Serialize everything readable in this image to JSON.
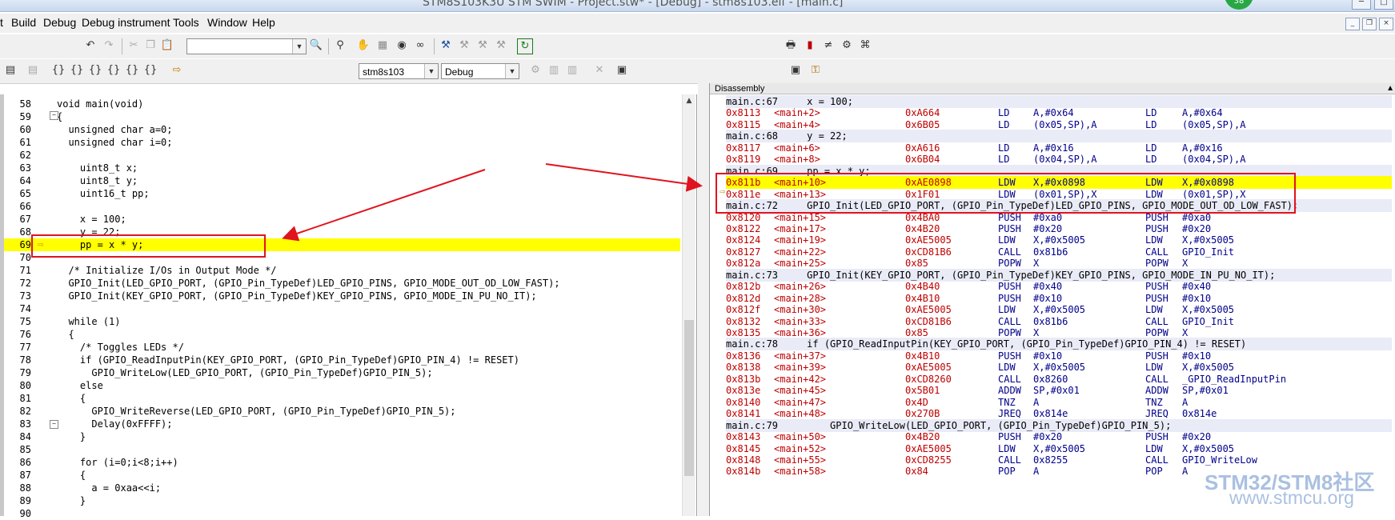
{
  "window": {
    "title": "STM8S103K3U STM SWIM - Project.stw* - [Debug] - stm8s103.elf - [main.c]",
    "badge": "38"
  },
  "menu": [
    "t",
    "Build",
    "Debug",
    "Debug instrument",
    "Tools",
    "Window",
    "Help"
  ],
  "toolbar": {
    "search_combo": "",
    "target_combo": "stm8s103",
    "config_combo": "Debug"
  },
  "editor": {
    "lines": [
      {
        "n": "58",
        "t": "void main(void)"
      },
      {
        "n": "59",
        "t": "{"
      },
      {
        "n": "60",
        "t": "  unsigned char a=0;"
      },
      {
        "n": "61",
        "t": "  unsigned char i=0;"
      },
      {
        "n": "62",
        "t": ""
      },
      {
        "n": "63",
        "t": "    uint8_t x;"
      },
      {
        "n": "64",
        "t": "    uint8_t y;"
      },
      {
        "n": "65",
        "t": "    uint16_t pp;"
      },
      {
        "n": "66",
        "t": ""
      },
      {
        "n": "67",
        "t": "    x = 100;"
      },
      {
        "n": "68",
        "t": "    y = 22;"
      },
      {
        "n": "69",
        "t": "    pp = x * y;"
      },
      {
        "n": "70",
        "t": ""
      },
      {
        "n": "71",
        "t": "  /* Initialize I/Os in Output Mode */"
      },
      {
        "n": "72",
        "t": "  GPIO_Init(LED_GPIO_PORT, (GPIO_Pin_TypeDef)LED_GPIO_PINS, GPIO_MODE_OUT_OD_LOW_FAST);"
      },
      {
        "n": "73",
        "t": "  GPIO_Init(KEY_GPIO_PORT, (GPIO_Pin_TypeDef)KEY_GPIO_PINS, GPIO_MODE_IN_PU_NO_IT);"
      },
      {
        "n": "74",
        "t": ""
      },
      {
        "n": "75",
        "t": "  while (1)"
      },
      {
        "n": "76",
        "t": "  {"
      },
      {
        "n": "77",
        "t": "    /* Toggles LEDs */"
      },
      {
        "n": "78",
        "t": "    if (GPIO_ReadInputPin(KEY_GPIO_PORT, (GPIO_Pin_TypeDef)GPIO_PIN_4) != RESET)"
      },
      {
        "n": "79",
        "t": "      GPIO_WriteLow(LED_GPIO_PORT, (GPIO_Pin_TypeDef)GPIO_PIN_5);"
      },
      {
        "n": "80",
        "t": "    else"
      },
      {
        "n": "81",
        "t": "    {"
      },
      {
        "n": "82",
        "t": "      GPIO_WriteReverse(LED_GPIO_PORT, (GPIO_Pin_TypeDef)GPIO_PIN_5);"
      },
      {
        "n": "83",
        "t": "      Delay(0xFFFF);"
      },
      {
        "n": "84",
        "t": "    }"
      },
      {
        "n": "85",
        "t": ""
      },
      {
        "n": "86",
        "t": "    for (i=0;i<8;i++)"
      },
      {
        "n": "87",
        "t": "    {"
      },
      {
        "n": "88",
        "t": "      a = 0xaa<<i;"
      },
      {
        "n": "89",
        "t": "    }"
      },
      {
        "n": "90",
        "t": ""
      }
    ]
  },
  "disassembly": {
    "title": "Disassembly",
    "rows": [
      {
        "kind": "src",
        "text": "main.c:67     x = 100;"
      },
      {
        "kind": "asm",
        "addr": "0x8113",
        "sym": "<main+2>",
        "hex": "0xA664",
        "op": "LD",
        "arg": "A,#0x64",
        "op2": "LD",
        "arg2": "A,#0x64"
      },
      {
        "kind": "asm",
        "addr": "0x8115",
        "sym": "<main+4>",
        "hex": "0x6B05",
        "op": "LD",
        "arg": "(0x05,SP),A",
        "op2": "LD",
        "arg2": "(0x05,SP),A"
      },
      {
        "kind": "src",
        "text": "main.c:68     y = 22;"
      },
      {
        "kind": "asm",
        "addr": "0x8117",
        "sym": "<main+6>",
        "hex": "0xA616",
        "op": "LD",
        "arg": "A,#0x16",
        "op2": "LD",
        "arg2": "A,#0x16"
      },
      {
        "kind": "asm",
        "addr": "0x8119",
        "sym": "<main+8>",
        "hex": "0x6B04",
        "op": "LD",
        "arg": "(0x04,SP),A",
        "op2": "LD",
        "arg2": "(0x04,SP),A"
      },
      {
        "kind": "src",
        "text": "main.c:69     pp = x * y;"
      },
      {
        "kind": "cur",
        "addr": "0x811b",
        "sym": "<main+10>",
        "hex": "0xAE0898",
        "op": "LDW",
        "arg": "X,#0x0898",
        "op2": "LDW",
        "arg2": "X,#0x0898"
      },
      {
        "kind": "asm",
        "addr": "0x811e",
        "sym": "<main+13>",
        "hex": "0x1F01",
        "op": "LDW",
        "arg": "(0x01,SP),X",
        "op2": "LDW",
        "arg2": "(0x01,SP),X"
      },
      {
        "kind": "src",
        "text": "main.c:72     GPIO_Init(LED_GPIO_PORT, (GPIO_Pin_TypeDef)LED_GPIO_PINS, GPIO_MODE_OUT_OD_LOW_FAST);"
      },
      {
        "kind": "asm",
        "addr": "0x8120",
        "sym": "<main+15>",
        "hex": "0x4BA0",
        "op": "PUSH",
        "arg": "#0xa0",
        "op2": "PUSH",
        "arg2": "#0xa0"
      },
      {
        "kind": "asm",
        "addr": "0x8122",
        "sym": "<main+17>",
        "hex": "0x4B20",
        "op": "PUSH",
        "arg": "#0x20",
        "op2": "PUSH",
        "arg2": "#0x20"
      },
      {
        "kind": "asm",
        "addr": "0x8124",
        "sym": "<main+19>",
        "hex": "0xAE5005",
        "op": "LDW",
        "arg": "X,#0x5005",
        "op2": "LDW",
        "arg2": "X,#0x5005"
      },
      {
        "kind": "asm",
        "addr": "0x8127",
        "sym": "<main+22>",
        "hex": "0xCD81B6",
        "op": "CALL",
        "arg": "0x81b6",
        "op2": "CALL",
        "arg2": "GPIO_Init"
      },
      {
        "kind": "asm",
        "addr": "0x812a",
        "sym": "<main+25>",
        "hex": "0x85",
        "op": "POPW",
        "arg": "X",
        "op2": "POPW",
        "arg2": "X"
      },
      {
        "kind": "src",
        "text": "main.c:73     GPIO_Init(KEY_GPIO_PORT, (GPIO_Pin_TypeDef)KEY_GPIO_PINS, GPIO_MODE_IN_PU_NO_IT);"
      },
      {
        "kind": "asm",
        "addr": "0x812b",
        "sym": "<main+26>",
        "hex": "0x4B40",
        "op": "PUSH",
        "arg": "#0x40",
        "op2": "PUSH",
        "arg2": "#0x40"
      },
      {
        "kind": "asm",
        "addr": "0x812d",
        "sym": "<main+28>",
        "hex": "0x4B10",
        "op": "PUSH",
        "arg": "#0x10",
        "op2": "PUSH",
        "arg2": "#0x10"
      },
      {
        "kind": "asm",
        "addr": "0x812f",
        "sym": "<main+30>",
        "hex": "0xAE5005",
        "op": "LDW",
        "arg": "X,#0x5005",
        "op2": "LDW",
        "arg2": "X,#0x5005"
      },
      {
        "kind": "asm",
        "addr": "0x8132",
        "sym": "<main+33>",
        "hex": "0xCD81B6",
        "op": "CALL",
        "arg": "0x81b6",
        "op2": "CALL",
        "arg2": "GPIO_Init"
      },
      {
        "kind": "asm",
        "addr": "0x8135",
        "sym": "<main+36>",
        "hex": "0x85",
        "op": "POPW",
        "arg": "X",
        "op2": "POPW",
        "arg2": "X"
      },
      {
        "kind": "src",
        "text": "main.c:78     if (GPIO_ReadInputPin(KEY_GPIO_PORT, (GPIO_Pin_TypeDef)GPIO_PIN_4) != RESET)"
      },
      {
        "kind": "asm",
        "addr": "0x8136",
        "sym": "<main+37>",
        "hex": "0x4B10",
        "op": "PUSH",
        "arg": "#0x10",
        "op2": "PUSH",
        "arg2": "#0x10"
      },
      {
        "kind": "asm",
        "addr": "0x8138",
        "sym": "<main+39>",
        "hex": "0xAE5005",
        "op": "LDW",
        "arg": "X,#0x5005",
        "op2": "LDW",
        "arg2": "X,#0x5005"
      },
      {
        "kind": "asm",
        "addr": "0x813b",
        "sym": "<main+42>",
        "hex": "0xCD8260",
        "op": "CALL",
        "arg": "0x8260",
        "op2": "CALL",
        "arg2": "_GPIO_ReadInputPin"
      },
      {
        "kind": "asm",
        "addr": "0x813e",
        "sym": "<main+45>",
        "hex": "0x5B01",
        "op": "ADDW",
        "arg": "SP,#0x01",
        "op2": "ADDW",
        "arg2": "SP,#0x01"
      },
      {
        "kind": "asm",
        "addr": "0x8140",
        "sym": "<main+47>",
        "hex": "0x4D",
        "op": "TNZ",
        "arg": "A",
        "op2": "TNZ",
        "arg2": "A"
      },
      {
        "kind": "asm",
        "addr": "0x8141",
        "sym": "<main+48>",
        "hex": "0x270B",
        "op": "JREQ",
        "arg": "0x814e",
        "op2": "JREQ",
        "arg2": "0x814e"
      },
      {
        "kind": "src",
        "text": "main.c:79         GPIO_WriteLow(LED_GPIO_PORT, (GPIO_Pin_TypeDef)GPIO_PIN_5);"
      },
      {
        "kind": "asm",
        "addr": "0x8143",
        "sym": "<main+50>",
        "hex": "0x4B20",
        "op": "PUSH",
        "arg": "#0x20",
        "op2": "PUSH",
        "arg2": "#0x20"
      },
      {
        "kind": "asm",
        "addr": "0x8145",
        "sym": "<main+52>",
        "hex": "0xAE5005",
        "op": "LDW",
        "arg": "X,#0x5005",
        "op2": "LDW",
        "arg2": "X,#0x5005"
      },
      {
        "kind": "asm",
        "addr": "0x8148",
        "sym": "<main+55>",
        "hex": "0xCD8255",
        "op": "CALL",
        "arg": "0x8255",
        "op2": "CALL",
        "arg2": "GPIO_WriteLow"
      },
      {
        "kind": "asm",
        "addr": "0x814b",
        "sym": "<main+58>",
        "hex": "0x84",
        "op": "POP",
        "arg": "A",
        "op2": "POP",
        "arg2": "A"
      }
    ]
  },
  "watermark": {
    "line1": "STM32/STM8社区",
    "line2": "www.stmcu.org"
  },
  "colors": {
    "current_line": "#ffff00",
    "highlight_box": "#e0141e",
    "source_row": "#e9ebf7"
  }
}
